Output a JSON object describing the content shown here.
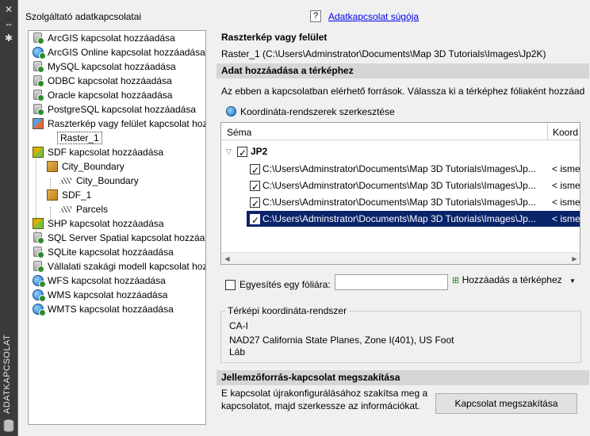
{
  "sidebar": {
    "close_glyph": "✕",
    "pin_glyph": "⇔",
    "settings_glyph": "✱",
    "vertical_title": "ADATKAPCSOLAT"
  },
  "provider_panel": {
    "title": "Szolgáltató adatkapcsolatai",
    "tree": [
      {
        "label": "ArcGIS kapcsolat hozzáadása",
        "icon": "database-icon"
      },
      {
        "label": "ArcGIS Online kapcsolat hozzáadása",
        "icon": "globe-icon"
      },
      {
        "label": "MySQL kapcsolat hozzáadása",
        "icon": "database-icon"
      },
      {
        "label": "ODBC kapcsolat hozzáadása",
        "icon": "database-icon"
      },
      {
        "label": "Oracle kapcsolat hozzáadása",
        "icon": "database-icon"
      },
      {
        "label": "PostgreSQL kapcsolat hozzáadása",
        "icon": "database-icon"
      },
      {
        "label": "Raszterkép vagy felület kapcsolat hozzáadása",
        "icon": "raster-icon"
      },
      {
        "label": "Raster_1",
        "icon": ""
      },
      {
        "label": "SDF kapcsolat hozzáadása",
        "icon": "sdf-icon"
      },
      {
        "label": "City_Boundary",
        "icon": "sdf-file-icon"
      },
      {
        "label": "City_Boundary",
        "icon": "layer-icon"
      },
      {
        "label": "SDF_1",
        "icon": "sdf-file-icon"
      },
      {
        "label": "Parcels",
        "icon": "layer-icon"
      },
      {
        "label": "SHP kapcsolat hozzáadása",
        "icon": "shp-icon"
      },
      {
        "label": "SQL Server Spatial kapcsolat hozzáadása",
        "icon": "database-icon"
      },
      {
        "label": "SQLite kapcsolat hozzáadása",
        "icon": "database-icon"
      },
      {
        "label": "Vállalati szakági modell kapcsolat hozzáadása",
        "icon": "database-icon"
      },
      {
        "label": "WFS kapcsolat hozzáadása",
        "icon": "globe-icon"
      },
      {
        "label": "WMS kapcsolat hozzáadása",
        "icon": "globe-icon"
      },
      {
        "label": "WMTS kapcsolat hozzáadása",
        "icon": "globe-icon"
      }
    ]
  },
  "help": {
    "icon_glyph": "?",
    "link_label": "Adatkapcsolat súgója"
  },
  "connection": {
    "heading": "Raszterkép vagy felület",
    "path": "Raster_1 (C:\\Users\\Adminstrator\\Documents\\Map 3D Tutorials\\Images\\Jp2K)"
  },
  "add_to_map": {
    "section_title": "Adat hozzáadása a térképhez",
    "description": "Az ebben a kapcsolatban elérhető források. Válassza ki a térképhez fóliaként hozzáad",
    "edit_crs_button": "Koordináta-rendszerek szerkesztése",
    "grid": {
      "col_schema": "Séma",
      "col_coord": "Koord",
      "group_label": "JP2",
      "rows": [
        {
          "path": "C:\\Users\\Adminstrator\\Documents\\Map 3D Tutorials\\Images\\Jp...",
          "coord": "< isme",
          "selected": false
        },
        {
          "path": "C:\\Users\\Adminstrator\\Documents\\Map 3D Tutorials\\Images\\Jp...",
          "coord": "< isme",
          "selected": false
        },
        {
          "path": "C:\\Users\\Adminstrator\\Documents\\Map 3D Tutorials\\Images\\Jp...",
          "coord": "< isme",
          "selected": false
        },
        {
          "path": "C:\\Users\\Adminstrator\\Documents\\Map 3D Tutorials\\Images\\Jp...",
          "coord": "< isme",
          "selected": true
        }
      ]
    },
    "combine_label": "Egyesítés egy fóliára:",
    "combine_value": "",
    "add_button": "Hozzáadás a térképhez"
  },
  "crs": {
    "group_title": "Térképi koordináta-rendszer",
    "code": "CA-I",
    "description": "NAD27 California State Planes, Zone I(401), US Foot",
    "unit": "Láb"
  },
  "disconnect": {
    "section_title": "Jellemzőforrás-kapcsolat megszakítása",
    "description_line1": "E kapcsolat újrakonfigurálásához szakítsa meg a",
    "description_line2": "kapcsolatot, majd szerkessze az információkat.",
    "button": "Kapcsolat megszakítása"
  }
}
